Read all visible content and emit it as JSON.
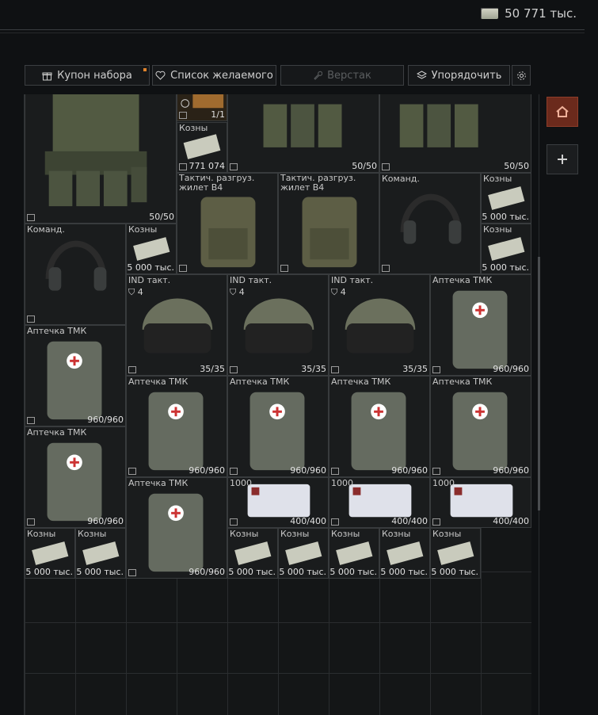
{
  "header": {
    "money": "50 771 тыс."
  },
  "toolbar": {
    "kit_coupon": "Купон набора",
    "wishlist": "Список желаемого",
    "workbench": "Верстак",
    "sort": "Упорядочить"
  },
  "items": {
    "vest1": {
      "count": "50/50"
    },
    "vest2": {
      "count": "50/50"
    },
    "vest3": {
      "count": "50/50"
    },
    "mapitem": {
      "count": "1/1"
    },
    "cash_top": {
      "name": "Козны",
      "count": "771 074"
    },
    "rig1": {
      "name": "Тактич. разгруз. жилет В4"
    },
    "rig2": {
      "name": "Тактич. разгруз. жилет В4"
    },
    "headset1": {
      "name": "Команд."
    },
    "headset2": {
      "name": "Команд."
    },
    "cash1": {
      "name": "Козны",
      "count": "5 000 тыс."
    },
    "cash2": {
      "name": "Козны",
      "count": "5 000 тыс."
    },
    "cash3": {
      "name": "Козны",
      "count": "5 000 тыс."
    },
    "helmet1": {
      "name": "IND такт.",
      "class": "4",
      "count": "35/35"
    },
    "helmet2": {
      "name": "IND такт.",
      "class": "4",
      "count": "35/35"
    },
    "helmet3": {
      "name": "IND такт.",
      "class": "4",
      "count": "35/35"
    },
    "med": {
      "name": "Аптечка ТМК",
      "count": "960/960"
    },
    "bandage": {
      "name": "1000",
      "count": "400/400"
    },
    "cash_row": {
      "name": "Козны",
      "count": "5 000 тыс."
    }
  }
}
